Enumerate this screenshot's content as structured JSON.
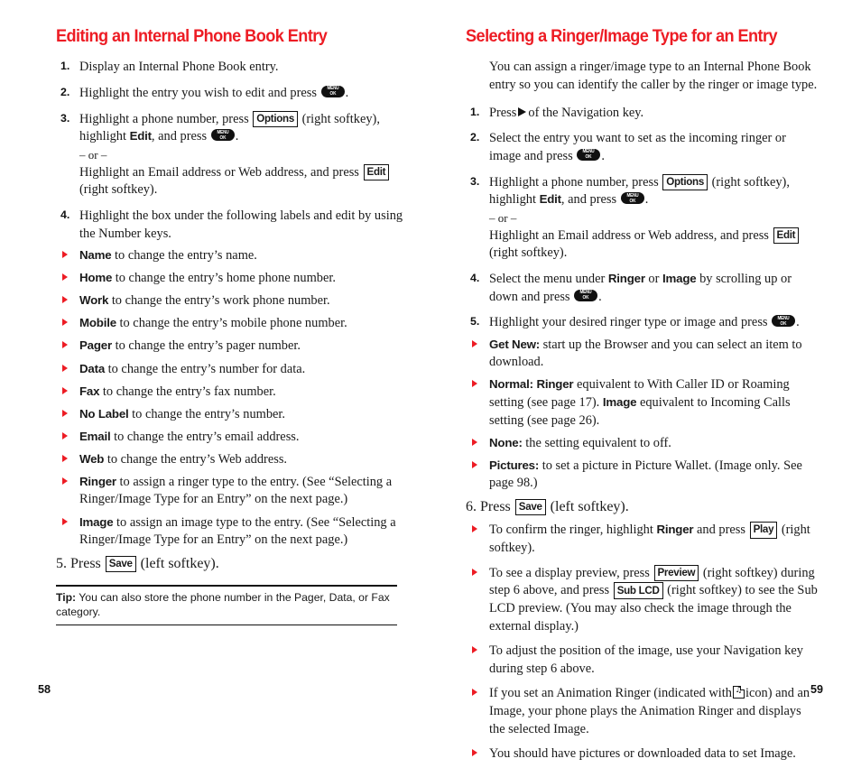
{
  "left_page": {
    "heading": "Editing an Internal Phone Book Entry",
    "folio": "58",
    "steps": [
      {
        "num": "1.",
        "text": "Display an Internal Phone Book entry."
      },
      {
        "num": "2.",
        "text_before": "Highlight the entry you wish to edit and press",
        "key": "menu-ok",
        "text_after": "."
      },
      {
        "num": "3.",
        "t1": "Highlight a phone number, press",
        "softkey1": "Options",
        "t2": "(right softkey),",
        "t3": "highlight",
        "term1": "Edit",
        "t4": ", and press",
        "key": "menu-ok",
        "t5": ".",
        "or": "– or –",
        "t6": "Highlight an Email address or Web address, and press",
        "softkey2": "Edit",
        "t7": "(right softkey)."
      },
      {
        "num": "4.",
        "text": "Highlight the box under the following labels and edit by using the Number keys."
      }
    ],
    "bullets": [
      {
        "term": "Name",
        "text": "to change the entry’s name."
      },
      {
        "term": "Home",
        "text": "to change the entry’s home phone number."
      },
      {
        "term": "Work",
        "text": "to change the entry’s work phone number."
      },
      {
        "term": "Mobile",
        "text": "to change the entry’s mobile phone number."
      },
      {
        "term": "Pager",
        "text": "to change the entry’s pager number."
      },
      {
        "term": "Data",
        "text": "to change the entry’s number for data."
      },
      {
        "term": "Fax",
        "text": "to change the entry’s fax number."
      },
      {
        "term": "No Label",
        "text": "to change the entry’s number."
      },
      {
        "term": "Email",
        "text": "to change the entry’s email address."
      },
      {
        "term": "Web",
        "text": "to change the entry’s Web address."
      },
      {
        "term": "Ringer",
        "text": "to assign a ringer type to the entry. (See “Selecting a Ringer/Image Type for an Entry” on the next page.)"
      },
      {
        "term": "Image",
        "text": "to assign an image type to the entry. (See “Selecting a Ringer/Image Type for an Entry” on the next page.)"
      }
    ],
    "step5": {
      "num": "5.",
      "t1": "Press",
      "softkey": "Save",
      "t2": "(left softkey)."
    },
    "tip": {
      "label": "Tip:",
      "text": "You can also store the phone number in the Pager, Data, or Fax category."
    }
  },
  "right_page": {
    "heading": "Selecting a Ringer/Image Type for an Entry",
    "folio": "59",
    "intro": "You can assign a ringer/image type to an Internal Phone Book entry so you can identify the caller by the ringer or image type.",
    "steps": [
      {
        "num": "1.",
        "t1": "Press",
        "icon": "navigation-right-triangle",
        "t2": "of the Navigation key."
      },
      {
        "num": "2.",
        "t1": "Select the entry you want to set as the incoming ringer or image and press",
        "key": "menu-ok",
        "t2": "."
      },
      {
        "num": "3.",
        "t1": "Highlight a phone number, press",
        "softkey1": "Options",
        "t2": "(right softkey),",
        "t3": "highlight",
        "term1": "Edit",
        "t4": ", and press",
        "key": "menu-ok",
        "t5": ".",
        "or": "– or –",
        "t6": "Highlight an Email address or Web address, and press",
        "softkey2": "Edit",
        "t7": "(right softkey)."
      },
      {
        "num": "4.",
        "t1": "Select the menu under",
        "term1": "Ringer",
        "t2": "or",
        "term2": "Image",
        "t3": "by scrolling up or down and press",
        "key": "menu-ok",
        "t4": "."
      },
      {
        "num": "5.",
        "t1": "Highlight your desired ringer type or image and press",
        "key": "menu-ok",
        "t2": "."
      }
    ],
    "bullets": [
      {
        "term": "Get New:",
        "text": "start up the Browser and you can select an item to download."
      },
      {
        "term": "Normal:",
        "term_b": "Ringer",
        "t1": "equivalent to With Caller ID or Roaming setting (see page 17).",
        "term_c": "Image",
        "t2": "equivalent to Incoming Calls setting (see page 26)."
      },
      {
        "term": "None:",
        "text": "the setting equivalent to off."
      },
      {
        "term": "Pictures:",
        "text": "to set a picture in Picture Wallet. (Image only. See page 98.)"
      }
    ],
    "step6": {
      "num": "6.",
      "t1": "Press",
      "softkey": "Save",
      "t2": "(left softkey)."
    },
    "bullets2": [
      {
        "t1": "To confirm the ringer, highlight",
        "term1": "Ringer",
        "t2": "and press",
        "softkey1": "Play",
        "t3": "(right softkey)."
      },
      {
        "t1": "To see a display preview, press",
        "softkey1": "Preview",
        "t2": "(right softkey) during step 6 above, and press",
        "softkey2": "Sub LCD",
        "t3": "(right softkey) to see the Sub LCD preview. (You may also check the image through the external display.)"
      },
      {
        "t1": "To adjust the position of the image, use your Navigation key during step 6 above.",
        "plain": true
      },
      {
        "t1": "If you set an Animation Ringer (indicated with",
        "icon": "animation-ringer-icon",
        "t2": "icon) and an Image, your phone plays the Animation Ringer and displays the selected Image."
      },
      {
        "t1": "You should have pictures or downloaded data to set Image.",
        "plain": true
      }
    ]
  },
  "keys": {
    "menu_line1": "MENU",
    "menu_line2": "OK"
  }
}
